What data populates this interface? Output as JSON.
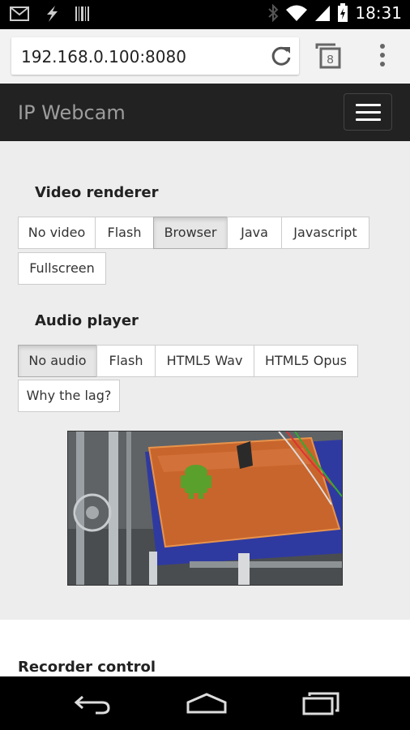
{
  "status_bar": {
    "time": "18:31",
    "icons": [
      "gmail-icon",
      "flash-icon",
      "barcode-icon",
      "bluetooth-icon",
      "wifi-icon",
      "signal-icon",
      "battery-icon"
    ]
  },
  "browser": {
    "url": "192.168.0.100:8080",
    "tab_count": "8"
  },
  "navbar": {
    "brand": "IP Webcam"
  },
  "video_renderer": {
    "title": "Video renderer",
    "options": [
      "No video",
      "Flash",
      "Browser",
      "Java",
      "Javascript",
      "Fullscreen"
    ],
    "selected": "Browser"
  },
  "audio_player": {
    "title": "Audio player",
    "options": [
      "No audio",
      "Flash",
      "HTML5 Wav",
      "HTML5 Opus",
      "Why the lag?"
    ],
    "selected": "No audio"
  },
  "recorder": {
    "title": "Recorder control"
  }
}
